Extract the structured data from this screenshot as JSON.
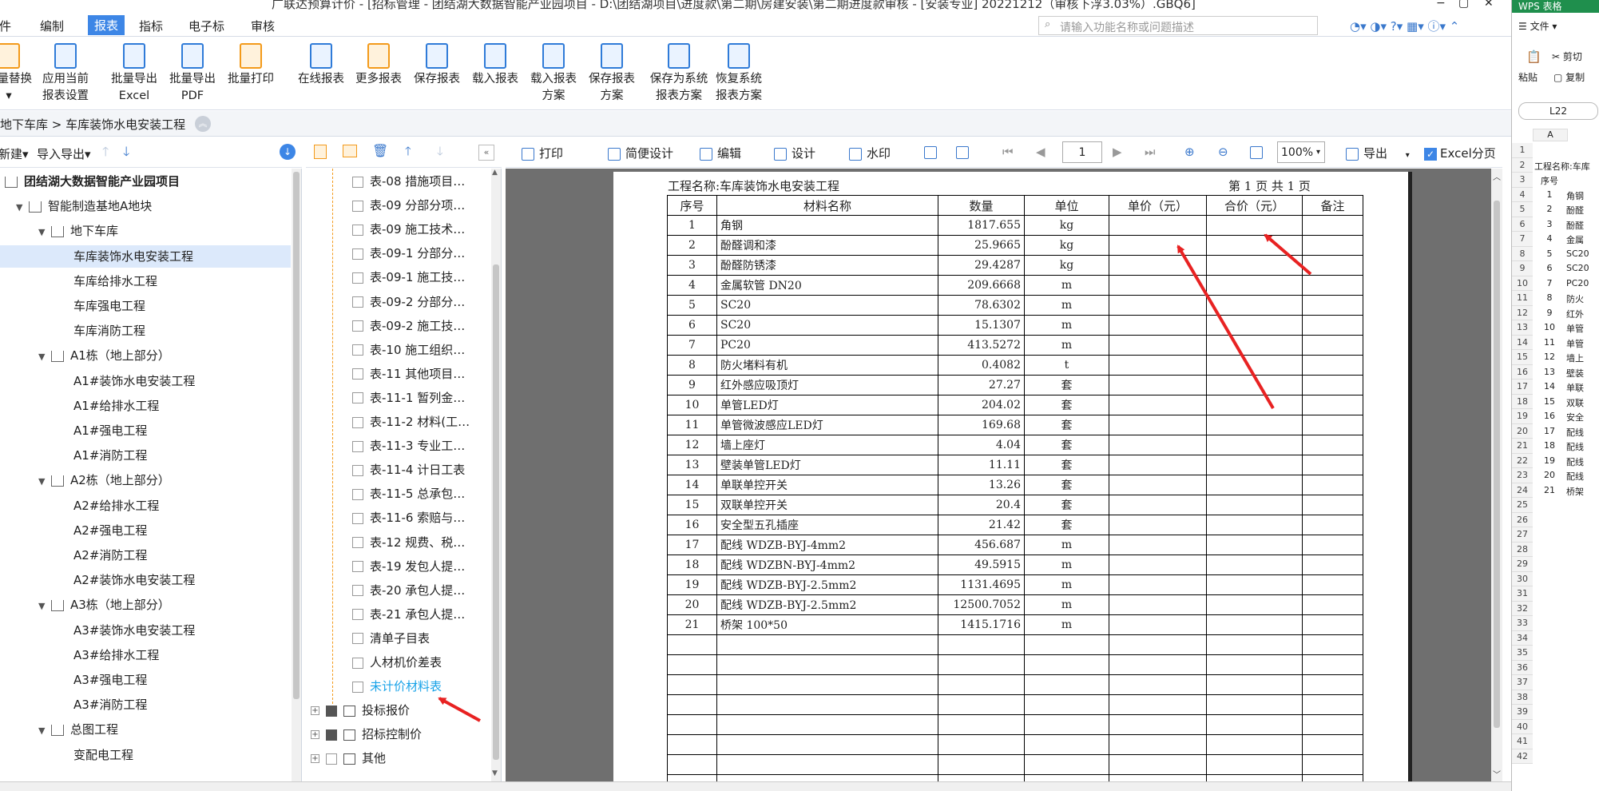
{
  "window": {
    "title": "广联达预算计价 - [招标管理 - 团结湖大数据智能产业园项目 - D:\\团结湖项目\\进度款\\第二期\\房建安装\\第二期进度款审核 - [安装专业] 20221212（审核下浮3.03%）.GBQ6]"
  },
  "menu": {
    "items": [
      "文件",
      "编制",
      "报表",
      "指标",
      "电子标",
      "审核"
    ],
    "active": "报表"
  },
  "search": {
    "placeholder": "请输入功能名称或问题描述"
  },
  "ribbon": {
    "buttons": [
      {
        "l1": "批量替换",
        "l2": "▾"
      },
      {
        "l1": "应用当前",
        "l2": "报表设置"
      },
      {
        "l1": "批量导出",
        "l2": "Excel"
      },
      {
        "l1": "批量导出",
        "l2": "PDF"
      },
      {
        "l1": "批量打印",
        "l2": ""
      },
      {
        "l1": "在线报表",
        "l2": ""
      },
      {
        "l1": "更多报表",
        "l2": ""
      },
      {
        "l1": "保存报表",
        "l2": ""
      },
      {
        "l1": "载入报表",
        "l2": ""
      },
      {
        "l1": "载入报表",
        "l2": "方案"
      },
      {
        "l1": "保存报表",
        "l2": "方案"
      },
      {
        "l1": "保存为系统",
        "l2": "报表方案"
      },
      {
        "l1": "恢复系统",
        "l2": "报表方案"
      }
    ]
  },
  "breadcrumb": "地下车库 > 车库装饰水电安装工程",
  "left_toolbar": {
    "new": "新建▾",
    "import_export": "导入导出▾"
  },
  "tree": [
    {
      "label": "团结湖大数据智能产业园项目",
      "level": 0,
      "type": "root"
    },
    {
      "label": "智能制造基地A地块",
      "level": 1,
      "type": "folder"
    },
    {
      "label": "地下车库",
      "level": 2,
      "type": "folder"
    },
    {
      "label": "车库装饰水电安装工程",
      "level": 3,
      "type": "leaf",
      "selected": true
    },
    {
      "label": "车库给排水工程",
      "level": 3,
      "type": "leaf"
    },
    {
      "label": "车库强电工程",
      "level": 3,
      "type": "leaf"
    },
    {
      "label": "车库消防工程",
      "level": 3,
      "type": "leaf"
    },
    {
      "label": "A1栋（地上部分）",
      "level": 2,
      "type": "folder"
    },
    {
      "label": "A1#装饰水电安装工程",
      "level": 3,
      "type": "leaf"
    },
    {
      "label": "A1#给排水工程",
      "level": 3,
      "type": "leaf"
    },
    {
      "label": "A1#强电工程",
      "level": 3,
      "type": "leaf"
    },
    {
      "label": "A1#消防工程",
      "level": 3,
      "type": "leaf"
    },
    {
      "label": "A2栋（地上部分）",
      "level": 2,
      "type": "folder"
    },
    {
      "label": "A2#给排水工程",
      "level": 3,
      "type": "leaf"
    },
    {
      "label": "A2#强电工程",
      "level": 3,
      "type": "leaf"
    },
    {
      "label": "A2#消防工程",
      "level": 3,
      "type": "leaf"
    },
    {
      "label": "A2#装饰水电安装工程",
      "level": 3,
      "type": "leaf"
    },
    {
      "label": "A3栋（地上部分）",
      "level": 2,
      "type": "folder"
    },
    {
      "label": "A3#装饰水电安装工程",
      "level": 3,
      "type": "leaf"
    },
    {
      "label": "A3#给排水工程",
      "level": 3,
      "type": "leaf"
    },
    {
      "label": "A3#强电工程",
      "level": 3,
      "type": "leaf"
    },
    {
      "label": "A3#消防工程",
      "level": 3,
      "type": "leaf"
    },
    {
      "label": "总图工程",
      "level": 2,
      "type": "folder"
    },
    {
      "label": "变配电工程",
      "level": 3,
      "type": "leaf"
    }
  ],
  "report_list": [
    {
      "label": "表-08 措施项目…",
      "kind": "child"
    },
    {
      "label": "表-09 分部分项…",
      "kind": "child"
    },
    {
      "label": "表-09 施工技术…",
      "kind": "child"
    },
    {
      "label": "表-09-1 分部分…",
      "kind": "child"
    },
    {
      "label": "表-09-1 施工技…",
      "kind": "child"
    },
    {
      "label": "表-09-2 分部分…",
      "kind": "child"
    },
    {
      "label": "表-09-2 施工技…",
      "kind": "child"
    },
    {
      "label": "表-10 施工组织…",
      "kind": "child"
    },
    {
      "label": "表-11 其他项目…",
      "kind": "child"
    },
    {
      "label": "表-11-1 暂列金…",
      "kind": "child"
    },
    {
      "label": "表-11-2 材料(工…",
      "kind": "child"
    },
    {
      "label": "表-11-3 专业工…",
      "kind": "child"
    },
    {
      "label": "表-11-4 计日工表",
      "kind": "child"
    },
    {
      "label": "表-11-5 总承包…",
      "kind": "child"
    },
    {
      "label": "表-11-6 索赔与…",
      "kind": "child"
    },
    {
      "label": "表-12 规费、税…",
      "kind": "child"
    },
    {
      "label": "表-19 发包人提…",
      "kind": "child"
    },
    {
      "label": "表-20 承包人提…",
      "kind": "child"
    },
    {
      "label": "表-21 承包人提…",
      "kind": "child"
    },
    {
      "label": "清单子目表",
      "kind": "child"
    },
    {
      "label": "人材机价差表",
      "kind": "child"
    },
    {
      "label": "未计价材料表",
      "kind": "child",
      "highlight": true
    },
    {
      "label": "投标报价",
      "kind": "group",
      "filled": true
    },
    {
      "label": "招标控制价",
      "kind": "group",
      "filled": true
    },
    {
      "label": "其他",
      "kind": "group",
      "filled": false
    }
  ],
  "preview_toolbar": {
    "print": "打印",
    "simple_design": "简便设计",
    "edit": "编辑",
    "design": "设计",
    "watermark": "水印",
    "page": "1",
    "zoom": "100%",
    "export": "导出",
    "excel_paging": "Excel分页"
  },
  "report": {
    "project": "工程名称:车库装饰水电安装工程",
    "page_info": "第  1  页  共  1  页",
    "headers": [
      "序号",
      "材料名称",
      "数量",
      "单位",
      "单价（元）",
      "合价（元）",
      "备注"
    ],
    "rows": [
      [
        "1",
        "角钢",
        "1817.655",
        "kg"
      ],
      [
        "2",
        "酚醛调和漆",
        "25.9665",
        "kg"
      ],
      [
        "3",
        "酚醛防锈漆",
        "29.4287",
        "kg"
      ],
      [
        "4",
        "金属软管 DN20",
        "209.6668",
        "m"
      ],
      [
        "5",
        "SC20",
        "78.6302",
        "m"
      ],
      [
        "6",
        "SC20",
        "15.1307",
        "m"
      ],
      [
        "7",
        "PC20",
        "413.5272",
        "m"
      ],
      [
        "8",
        "防火堵料有机",
        "0.4082",
        "t"
      ],
      [
        "9",
        "红外感应吸顶灯",
        "27.27",
        "套"
      ],
      [
        "10",
        "单管LED灯",
        "204.02",
        "套"
      ],
      [
        "11",
        "单管微波感应LED灯",
        "169.68",
        "套"
      ],
      [
        "12",
        "墙上座灯",
        "4.04",
        "套"
      ],
      [
        "13",
        "壁装单管LED灯",
        "11.11",
        "套"
      ],
      [
        "14",
        "单联单控开关",
        "13.26",
        "套"
      ],
      [
        "15",
        "双联单控开关",
        "20.4",
        "套"
      ],
      [
        "16",
        "安全型五孔插座",
        "21.42",
        "套"
      ],
      [
        "17",
        "配线 WDZB-BYJ-4mm2",
        "456.687",
        "m"
      ],
      [
        "18",
        "配线 WDZBN-BYJ-4mm2",
        "49.5915",
        "m"
      ],
      [
        "19",
        "配线 WDZB-BYJ-2.5mm2",
        "1131.4695",
        "m"
      ],
      [
        "20",
        "配线 WDZB-BYJ-2.5mm2",
        "12500.7052",
        "m"
      ],
      [
        "21",
        "桥架 100*50",
        "1415.1716",
        "m"
      ]
    ],
    "empty_rows": 8
  },
  "wps": {
    "title": "WPS 表格",
    "menu": "文件",
    "cut": "剪切",
    "paste": "粘贴",
    "copy": "复制",
    "cell_ref": "L22",
    "col_a": "A",
    "row_numbers": [
      "1",
      "2",
      "3",
      "4",
      "5",
      "6",
      "7",
      "8",
      "9",
      "10",
      "11",
      "12",
      "13",
      "14",
      "15",
      "16",
      "17",
      "18",
      "19",
      "20",
      "21",
      "22",
      "23",
      "24",
      "25",
      "26",
      "27",
      "28",
      "29",
      "30",
      "31",
      "32",
      "33",
      "34",
      "35",
      "36",
      "37",
      "38",
      "39",
      "40",
      "41",
      "42"
    ],
    "cells": [
      {
        "row": 2,
        "text": "工程名称:车库"
      },
      {
        "row": 3,
        "a": "序号"
      },
      {
        "row": 4,
        "a": "1",
        "b": "角钢"
      },
      {
        "row": 5,
        "a": "2",
        "b": "酚醛"
      },
      {
        "row": 6,
        "a": "3",
        "b": "酚醛"
      },
      {
        "row": 7,
        "a": "4",
        "b": "金属"
      },
      {
        "row": 8,
        "a": "5",
        "b": "SC20"
      },
      {
        "row": 9,
        "a": "6",
        "b": "SC20"
      },
      {
        "row": 10,
        "a": "7",
        "b": "PC20"
      },
      {
        "row": 11,
        "a": "8",
        "b": "防火"
      },
      {
        "row": 12,
        "a": "9",
        "b": "红外"
      },
      {
        "row": 13,
        "a": "10",
        "b": "单管"
      },
      {
        "row": 14,
        "a": "11",
        "b": "单管"
      },
      {
        "row": 15,
        "a": "12",
        "b": "墙上"
      },
      {
        "row": 16,
        "a": "13",
        "b": "壁装"
      },
      {
        "row": 17,
        "a": "14",
        "b": "单联"
      },
      {
        "row": 18,
        "a": "15",
        "b": "双联"
      },
      {
        "row": 19,
        "a": "16",
        "b": "安全"
      },
      {
        "row": 20,
        "a": "17",
        "b": "配线"
      },
      {
        "row": 21,
        "a": "18",
        "b": "配线"
      },
      {
        "row": 22,
        "a": "19",
        "b": "配线"
      },
      {
        "row": 23,
        "a": "20",
        "b": "配线"
      },
      {
        "row": 24,
        "a": "21",
        "b": "桥架"
      }
    ]
  },
  "colors": {
    "accent": "#3d86e6",
    "arrow": "#e82222",
    "highlight_text": "#1aa3e8"
  }
}
